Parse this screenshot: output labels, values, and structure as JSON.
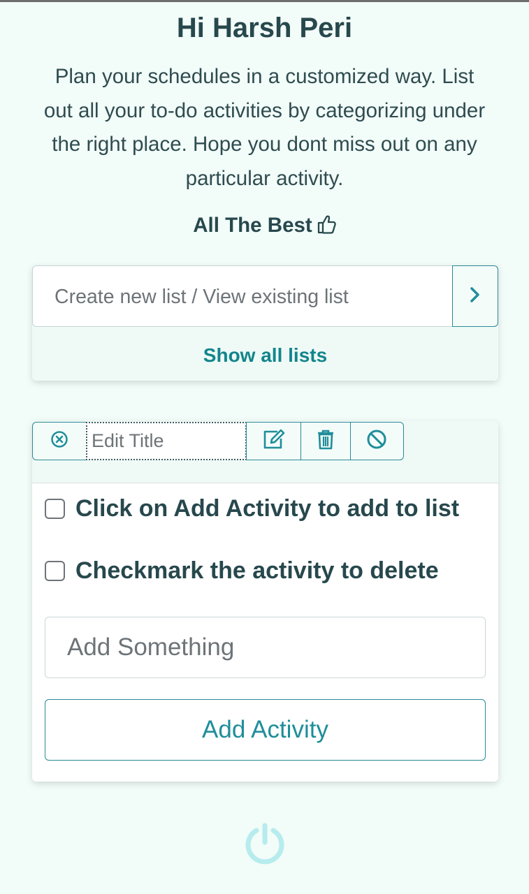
{
  "header": {
    "greeting": "Hi Harsh Peri",
    "intro": "Plan your schedules in a customized way. List out all your to-do activities by categorizing under the right place. Hope you dont miss out on any particular activity.",
    "wish": "All The Best",
    "wish_icon": "thumbs-up-icon"
  },
  "list_selector": {
    "input_placeholder": "Create new list / View existing list",
    "go_icon": "chevron-right-icon",
    "show_all_label": "Show all lists"
  },
  "todo_list": {
    "title_placeholder": "Edit Title",
    "toolbar_icons": [
      "close-circle-icon",
      "edit-icon",
      "trash-icon",
      "ban-icon"
    ],
    "items": [
      {
        "label": "Click on Add Activity to add to list",
        "checked": false
      },
      {
        "label": "Checkmark the activity to delete",
        "checked": false
      }
    ],
    "add_placeholder": "Add Something",
    "add_button_label": "Add Activity"
  },
  "footer": {
    "power_icon": "power-icon"
  },
  "colors": {
    "background": "#f2fcf8",
    "accent": "#12858c",
    "text": "#27484d",
    "power": "#b6ecee"
  }
}
